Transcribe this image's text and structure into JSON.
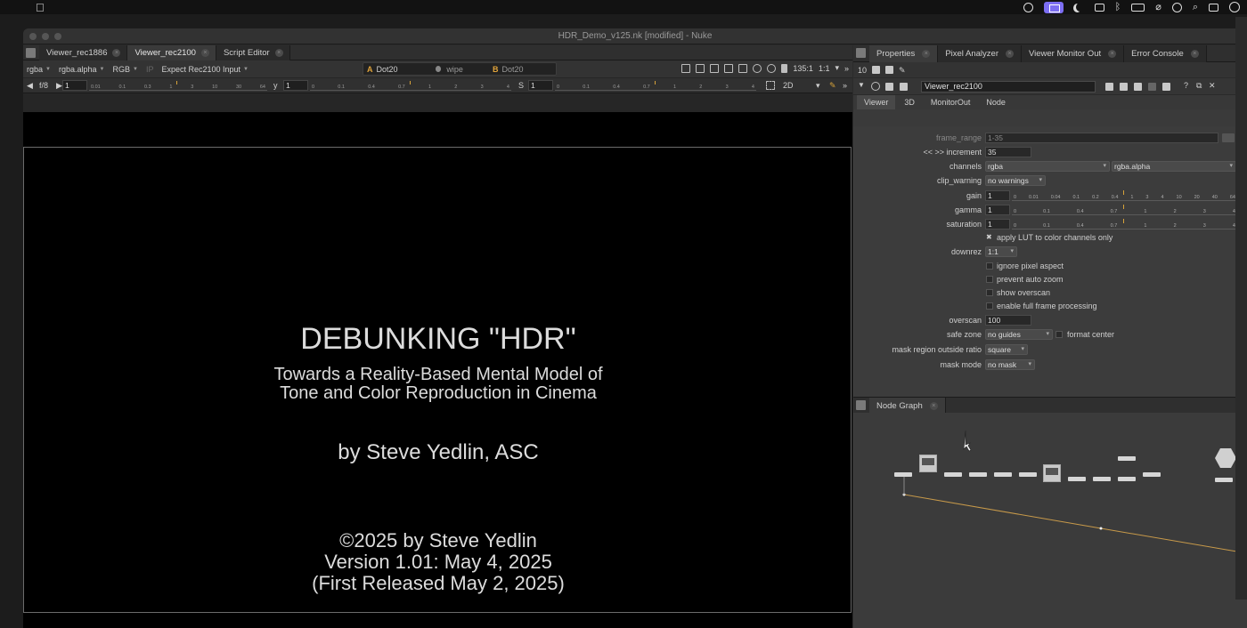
{
  "window_title": "HDR_Demo_v125.nk [modified] - Nuke",
  "viewer_tabs": [
    {
      "label": "Viewer_rec1886"
    },
    {
      "label": "Viewer_rec2100"
    },
    {
      "label": "Script Editor"
    }
  ],
  "viewer_toolbar": {
    "layer": "rgba",
    "channel": "rgba.alpha",
    "display": "RGB",
    "ip_label": "IP",
    "input_process": "Expect Rec2100 Input",
    "a_letter": "A",
    "a_input": "Dot20",
    "wipe": "wipe",
    "b_letter": "B",
    "b_input": "Dot20",
    "frame_value": "135:1",
    "zoom": "1:1",
    "view_mode": "2D"
  },
  "viewer_controls": {
    "fstop": "f/8",
    "gain_value": "1",
    "y_label": "y",
    "gamma_value": "1",
    "s_label": "S",
    "sat_value": "1",
    "gain_ticks": [
      "0.01",
      "0.1",
      "0.3",
      "1",
      "3",
      "10",
      "30",
      "64"
    ],
    "gamma_ticks": [
      "0",
      "0.1",
      "0.4",
      "0.7",
      "1",
      "2",
      "3",
      "4"
    ],
    "sat_ticks": [
      "0",
      "0.1",
      "0.4",
      "0.7",
      "1",
      "2",
      "3",
      "4"
    ]
  },
  "slide": {
    "title": "DEBUNKING \"HDR\"",
    "subtitle_line1": "Towards a Reality-Based Mental Model of",
    "subtitle_line2": "Tone and Color Reproduction in Cinema",
    "byline": "by Steve Yedlin, ASC",
    "copyright": "©2025 by Steve Yedlin",
    "version": "Version 1.01: May 4, 2025",
    "released": "(First Released May 2, 2025)"
  },
  "right_tabs": [
    {
      "label": "Properties"
    },
    {
      "label": "Pixel Analyzer"
    },
    {
      "label": "Viewer Monitor Out"
    },
    {
      "label": "Error Console"
    }
  ],
  "props_toolbar": {
    "count": "10"
  },
  "node_name": "Viewer_rec2100",
  "node_subtabs": [
    "Viewer",
    "3D",
    "MonitorOut",
    "Node"
  ],
  "knobs": {
    "frame_range_label": "frame_range",
    "frame_range_value": "1-35",
    "increment_label": "<< >> increment",
    "increment_value": "35",
    "channels_label": "channels",
    "channels_value": "rgba",
    "channels_alpha": "rgba.alpha",
    "clip_warning_label": "clip_warning",
    "clip_warning_value": "no warnings",
    "gain_label": "gain",
    "gain_value": "1",
    "gain_ticks": [
      "0",
      "0.01",
      "0.04",
      "0.1",
      "0.2",
      "0.4",
      "1",
      "3",
      "4",
      "10",
      "20",
      "40",
      "64"
    ],
    "gamma_label": "gamma",
    "gamma_value": "1",
    "gamma_ticks": [
      "0",
      "0.1",
      "0.4",
      "0.7",
      "1",
      "2",
      "3",
      "4"
    ],
    "saturation_label": "saturation",
    "saturation_value": "1",
    "saturation_ticks": [
      "0",
      "0.1",
      "0.4",
      "0.7",
      "1",
      "2",
      "3",
      "4"
    ],
    "apply_lut_label": "apply LUT to color channels only",
    "downrez_label": "downrez",
    "downrez_value": "1:1",
    "ignore_pixel_aspect": "ignore pixel aspect",
    "prevent_auto_zoom": "prevent auto zoom",
    "show_overscan": "show overscan",
    "full_frame": "enable full frame processing",
    "overscan_label": "overscan",
    "overscan_value": "100",
    "safe_zone_label": "safe zone",
    "safe_zone_value": "no guides",
    "format_center": "format center",
    "mask_region_label": "mask region outside ratio",
    "mask_region_value": "square",
    "mask_mode_label": "mask mode",
    "mask_mode_value": "no mask"
  },
  "node_graph_tab": "Node Graph",
  "colors": {
    "accent_orange": "#d7a33a",
    "screen_share_purple": "#7c6ef2",
    "wire": "#c89a4a"
  },
  "menubar_icons": [
    "apple-icon",
    "screen-record-icon",
    "screen-share-icon",
    "moon-icon",
    "display-icon",
    "bluetooth-icon",
    "battery-icon",
    "wifi-off-icon",
    "user-icon",
    "search-icon",
    "control-center-icon",
    "siri-icon"
  ]
}
